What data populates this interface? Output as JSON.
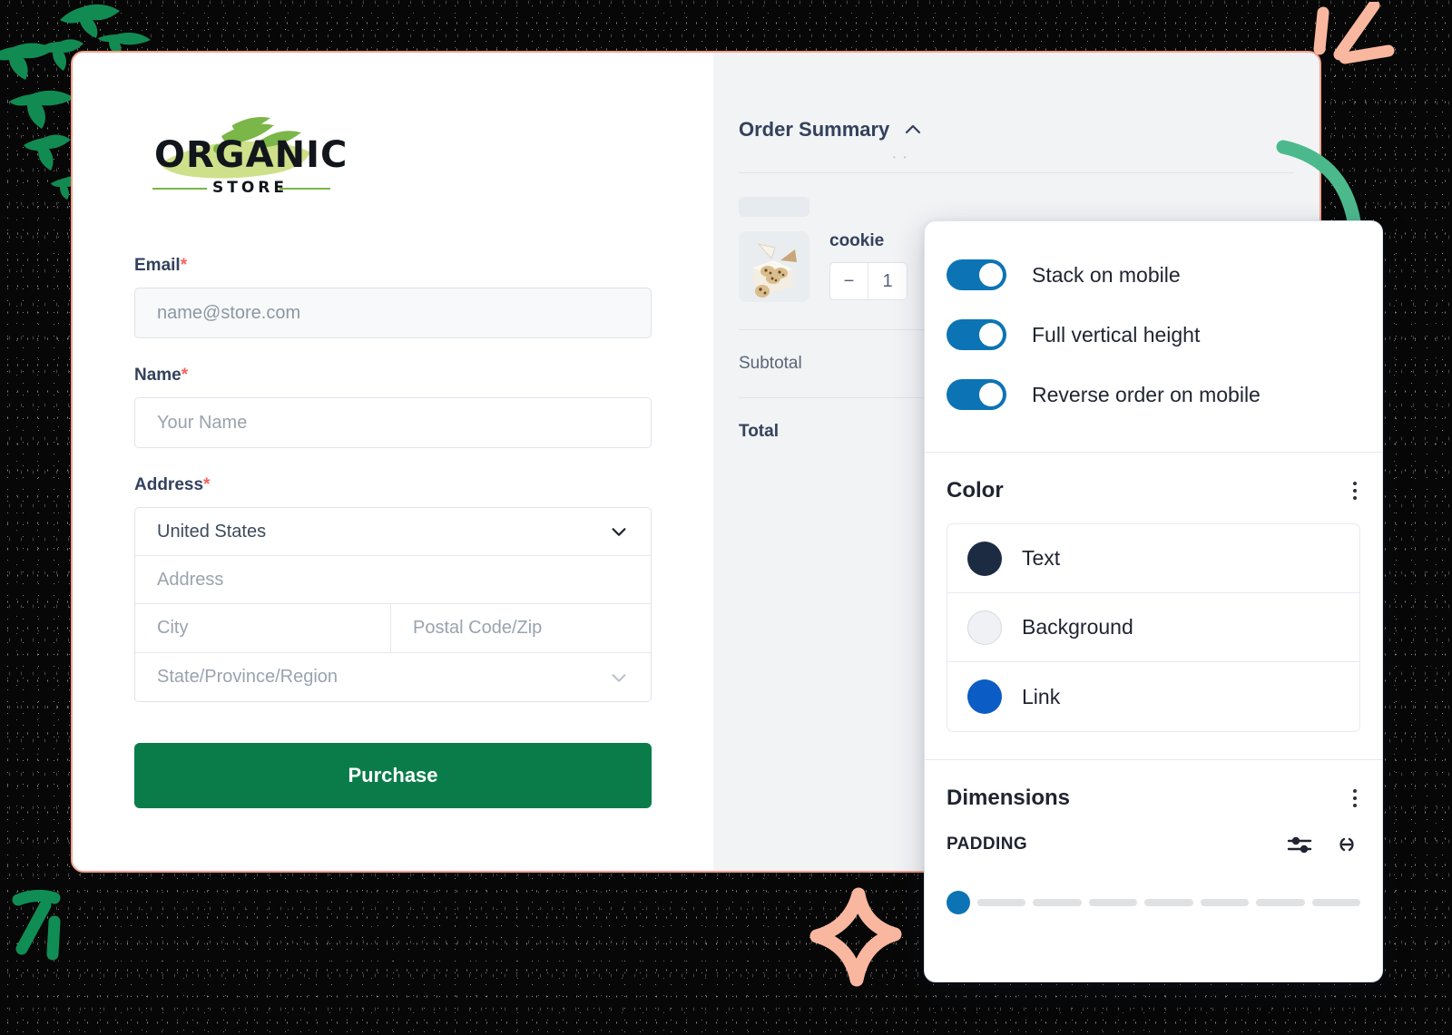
{
  "background": {
    "color": "#070707",
    "speckles": true
  },
  "card": {
    "border_color": "#f2a08a",
    "logo": {
      "name_top": "ORGANIC",
      "name_bottom": "STORE",
      "brush_color": "#cfe08a",
      "leaf_color": "#7ab648",
      "ink_color": "#12161c"
    },
    "form": {
      "email": {
        "label": "Email",
        "required_mark": "*",
        "placeholder": "name@store.com",
        "value": ""
      },
      "name": {
        "label": "Name",
        "required_mark": "*",
        "placeholder": "Your Name",
        "value": ""
      },
      "address": {
        "label": "Address",
        "required_mark": "*",
        "country_value": "United States",
        "street_placeholder": "Address",
        "city_placeholder": "City",
        "postal_placeholder": "Postal Code/Zip",
        "state_placeholder": "State/Province/Region"
      },
      "purchase_button": "Purchase",
      "purchase_button_color": "#0a7c4a"
    },
    "order_summary": {
      "title": "Order Summary",
      "collapse_icon": "chevron-up-icon",
      "item": {
        "name": "cookie",
        "quantity": "1",
        "decrement": "−"
      },
      "subtotal_label": "Subtotal",
      "subtotal_value": "",
      "total_label": "Total",
      "total_value": ""
    }
  },
  "panel": {
    "toggles": [
      {
        "label": "Stack on mobile",
        "on": true
      },
      {
        "label": "Full vertical height",
        "on": true
      },
      {
        "label": "Reverse order on mobile",
        "on": true
      }
    ],
    "toggle_color": "#0c74b4",
    "color_section": {
      "title": "Color",
      "menu_icon": "kebab-menu-icon",
      "swatches": [
        {
          "label": "Text",
          "color": "#1c2b42"
        },
        {
          "label": "Background",
          "color": "#eff1f4"
        },
        {
          "label": "Link",
          "color": "#0b5cc4"
        }
      ]
    },
    "dimensions_section": {
      "title": "Dimensions",
      "menu_icon": "kebab-menu-icon",
      "padding_label": "PADDING",
      "sliders_icon": "sliders-icon",
      "link_icon": "link-icon",
      "slider_value": 0,
      "slider_segments": 7,
      "slider_thumb_color": "#0c74b4"
    }
  },
  "doodles": {
    "top_left_sparkles_color": "#128b53",
    "top_right_strokes_color": "#f9b79f",
    "bottom_left_strokes_color": "#0f8d55",
    "bottom_star_color": "#f9b79f",
    "arrow_color": "#4cb98d"
  }
}
